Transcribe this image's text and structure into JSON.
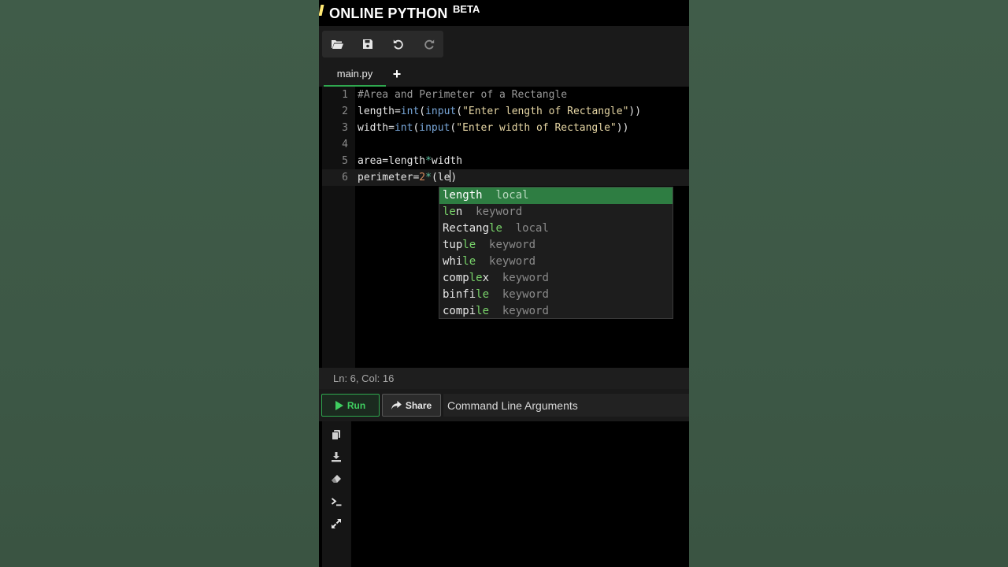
{
  "app": {
    "title": "ONLINE PYTHON",
    "badge": "BETA"
  },
  "toolbar": {
    "buttons": [
      {
        "icon": "folder-open-icon"
      },
      {
        "icon": "save-icon"
      },
      {
        "icon": "undo-icon"
      },
      {
        "icon": "redo-icon"
      }
    ]
  },
  "tabs": {
    "active": "main.py",
    "add_label": "+"
  },
  "editor": {
    "line_numbers": [
      "1",
      "2",
      "3",
      "4",
      "5",
      "6"
    ],
    "active_line": 6
  },
  "autocomplete": {
    "items": [
      {
        "prefix": "",
        "match": "le",
        "suffix": "ngth",
        "kind": "local",
        "selected": true
      },
      {
        "prefix": "",
        "match": "le",
        "suffix": "n",
        "kind": "keyword"
      },
      {
        "prefix": "Rectang",
        "match": "le",
        "suffix": "",
        "kind": "local"
      },
      {
        "prefix": "tup",
        "match": "le",
        "suffix": "",
        "kind": "keyword"
      },
      {
        "prefix": "whi",
        "match": "le",
        "suffix": "",
        "kind": "keyword"
      },
      {
        "prefix": "comp",
        "match": "le",
        "suffix": "x",
        "kind": "keyword"
      },
      {
        "prefix": "binfi",
        "match": "le",
        "suffix": "",
        "kind": "keyword"
      },
      {
        "prefix": "compi",
        "match": "le",
        "suffix": "",
        "kind": "keyword"
      }
    ]
  },
  "status": {
    "position": "Ln: 6,  Col: 16"
  },
  "run_bar": {
    "run_label": "Run",
    "share_label": "Share",
    "args_placeholder": "Command Line Arguments"
  },
  "output_tools": [
    "copy-icon",
    "download-icon",
    "eraser-icon",
    "terminal-icon",
    "expand-icon"
  ],
  "colors": {
    "accent": "#2fa84f",
    "background": "#000000",
    "page_bg": "#3f5b48"
  }
}
